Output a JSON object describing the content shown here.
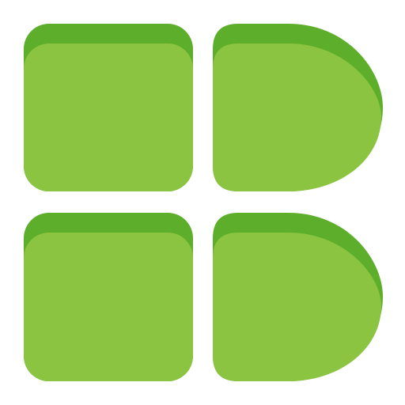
{
  "icon": {
    "name": "app-grid-logo",
    "colors": {
      "face": "#8BC441",
      "shadow": "#5DAE2A",
      "background": "#FFFFFF"
    }
  }
}
